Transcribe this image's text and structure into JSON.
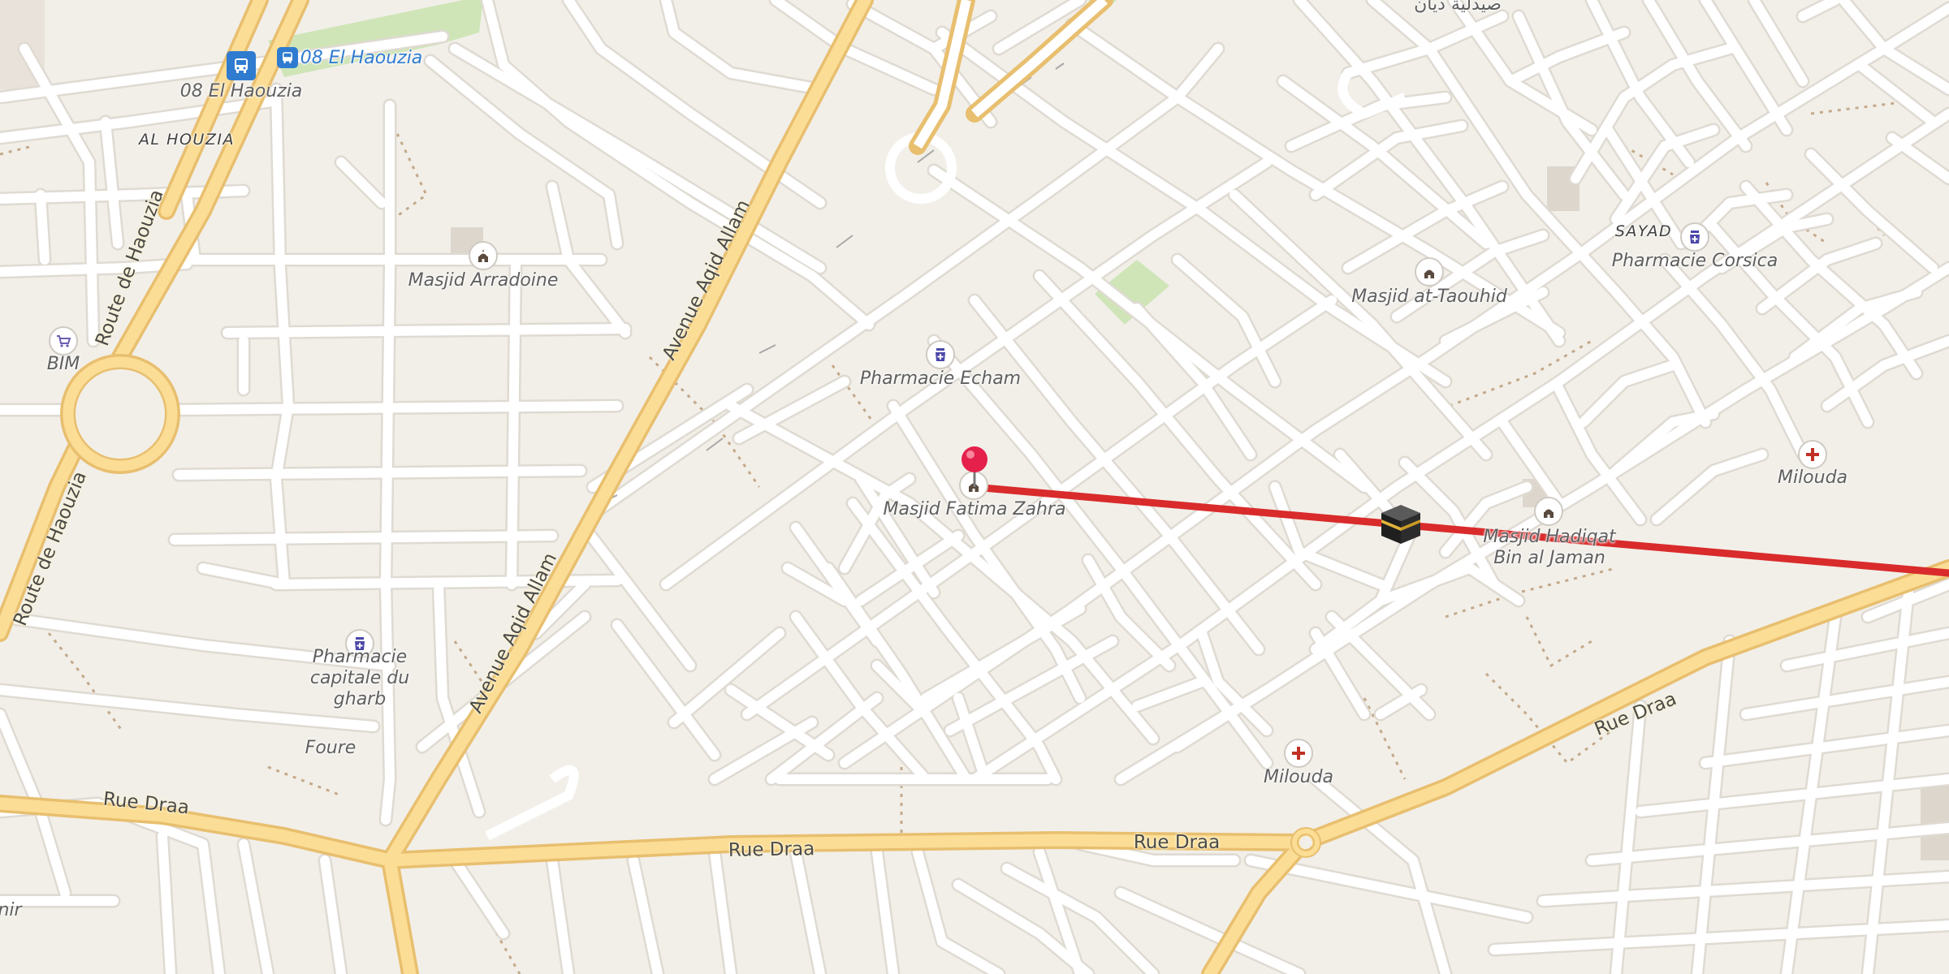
{
  "map": {
    "background": "#f2efe9",
    "road_minor_color": "#ffffff",
    "road_major_fill": "#fbdd95",
    "road_major_casing": "#e9bf6c",
    "route_line_color": "#d92b2b",
    "pin_color": "#e4204b"
  },
  "places": {
    "bus_stop_1": "08 El Haouzia",
    "bus_stop_2": "08 El Haouzia",
    "area_al_houzia": "AL HOUZIA",
    "area_sayad": "SAYAD",
    "masjid_arradoine": "Masjid Arradoine",
    "bim": "BIM",
    "pharmacie_echam": "Pharmacie Echam",
    "masjid_fatima_zahra": "Masjid Fatima Zahra",
    "masjid_at_taouhid": "Masjid at-Taouhid",
    "pharmacie_corsica": "Pharmacie Corsica",
    "milouda_right": "Milouda",
    "milouda_bottom": "Milouda",
    "masjid_hadiqat": "Masjid Hadiqat Bin al Jaman",
    "pharmacie_capitale": "Pharmacie capitale du gharb",
    "foure": "Foure",
    "arabic_top": "صيدلية ديان",
    "partial_left": "nir"
  },
  "roads": {
    "route_de_haouzia_1": "Route de Haouzia",
    "route_de_haouzia_2": "Route de Haouzia",
    "avenue_aqid_allam_1": "Avenue Aqid Allam",
    "avenue_aqid_allam_2": "Avenue Aqid Allam",
    "rue_draa_1": "Rue Draa",
    "rue_draa_2": "Rue Draa",
    "rue_draa_3": "Rue Draa",
    "rue_draa_4": "Rue Draa"
  },
  "icons": {
    "mosque": "mosque-icon",
    "pharmacy": "pharmacy-icon",
    "clinic": "clinic-cross-icon",
    "shop": "shopping-cart-icon",
    "bus": "bus-icon",
    "kaaba": "kaaba-qibla-icon",
    "pin": "location-pin-icon"
  }
}
